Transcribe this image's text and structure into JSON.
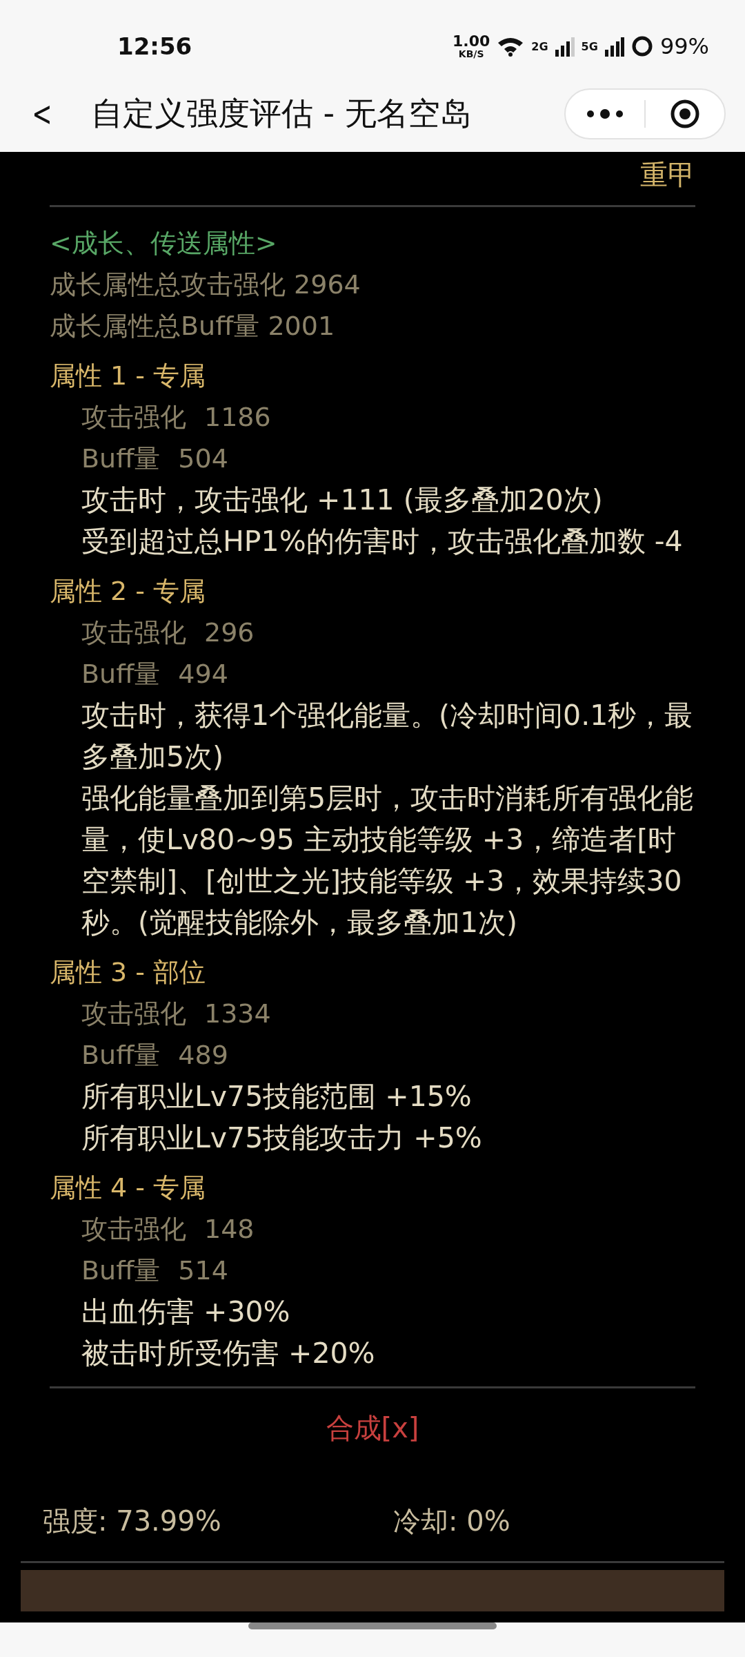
{
  "status_bar": {
    "time": "12:56",
    "speed": "1.00",
    "speed_unit": "KB/S",
    "net1": "2G",
    "net2": "5G",
    "battery": "99%"
  },
  "nav": {
    "back": "<",
    "title": "自定义强度评估 - 无名空岛"
  },
  "armor_type": "重甲",
  "growth": {
    "title": "<成长、传送属性>",
    "lines": [
      "成长属性总攻击强化 2964",
      "成长属性总Buff量 2001"
    ]
  },
  "attributes": [
    {
      "title": "属性 1 - 专属",
      "stats": [
        {
          "label": "攻击强化",
          "value": "1186"
        },
        {
          "label": "Buff量",
          "value": "504"
        }
      ],
      "effects": [
        "攻击时，攻击强化 +111 (最多叠加20次)",
        "受到超过总HP1%的伤害时，攻击强化叠加数 -4"
      ]
    },
    {
      "title": "属性 2 - 专属",
      "stats": [
        {
          "label": "攻击强化",
          "value": "296"
        },
        {
          "label": "Buff量",
          "value": "494"
        }
      ],
      "effects": [
        "攻击时，获得1个强化能量。(冷却时间0.1秒，最多叠加5次)",
        "强化能量叠加到第5层时，攻击时消耗所有强化能量，使Lv80~95 主动技能等级 +3，缔造者[时空禁制]、[创世之光]技能等级 +3，效果持续30秒。(觉醒技能除外，最多叠加1次)"
      ]
    },
    {
      "title": "属性 3 - 部位",
      "stats": [
        {
          "label": "攻击强化",
          "value": "1334"
        },
        {
          "label": "Buff量",
          "value": "489"
        }
      ],
      "effects": [
        "所有职业Lv75技能范围 +15%",
        "所有职业Lv75技能攻击力 +5%"
      ]
    },
    {
      "title": "属性 4 - 专属",
      "stats": [
        {
          "label": "攻击强化",
          "value": "148"
        },
        {
          "label": "Buff量",
          "value": "514"
        }
      ],
      "effects": [
        "出血伤害 +30%",
        "被击时所受伤害 +20%"
      ]
    }
  ],
  "synthesis": "合成[x]",
  "summary": {
    "strength": "强度: 73.99%",
    "cooldown": "冷却: 0%"
  }
}
